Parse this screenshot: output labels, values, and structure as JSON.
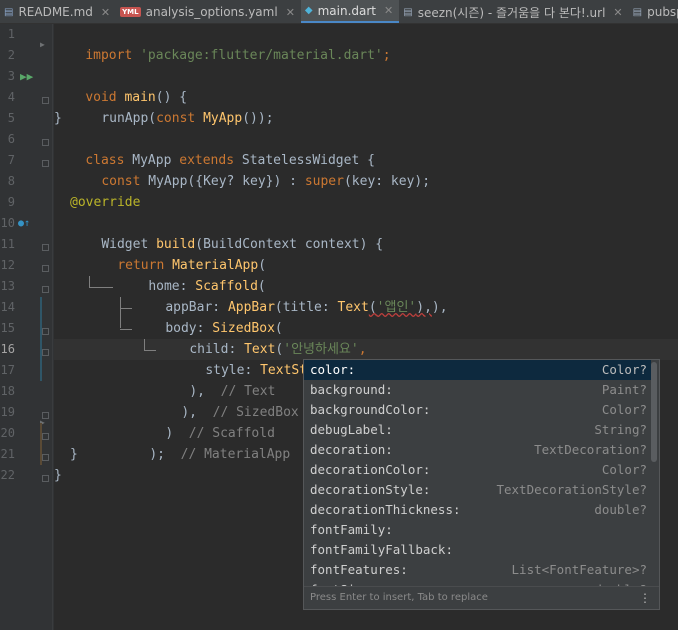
{
  "tabs": [
    {
      "label": "README.md",
      "icon": "markdown-file-icon",
      "active": false
    },
    {
      "label": "analysis_options.yaml",
      "icon": "yaml-file-icon",
      "active": false
    },
    {
      "label": "main.dart",
      "icon": "dart-file-icon",
      "active": true
    },
    {
      "label": "seezn(시즌) - 즐거움을 다 본다!.url",
      "icon": "url-file-icon",
      "active": false
    },
    {
      "label": "pubspe",
      "icon": "pubspec-file-icon",
      "active": false
    }
  ],
  "editor": {
    "line_numbers": [
      "1",
      "2",
      "3",
      "4",
      "5",
      "6",
      "7",
      "8",
      "9",
      "10",
      "11",
      "12",
      "13",
      "14",
      "15",
      "16",
      "17",
      "18",
      "19",
      "20",
      "21",
      "22"
    ],
    "current_line": "16",
    "code": {
      "l1_import": "import",
      "l1_str": "'package:flutter/material.dart'",
      "l1_semi": ";",
      "l3_void": "void",
      "l3_main": "main",
      "l3_rest": "() {",
      "l4_runapp": "runApp(",
      "l4_const": "const",
      "l4_myapp": "MyApp",
      "l4_end": "());",
      "l5": "}",
      "l6_class": "class",
      "l6_name": "MyApp",
      "l6_extends": "extends",
      "l6_base": "StatelessWidget {",
      "l7_const": "const",
      "l7_sig": "MyApp({Key? key}) : ",
      "l7_super": "super",
      "l7_end": "(key: key);",
      "l9_ann": "@override",
      "l10_type": "Widget",
      "l10_build": "build",
      "l10_params": "(BuildContext context) {",
      "l11_return": "return",
      "l11_widget": "MaterialApp",
      "l11_paren": "(",
      "l12_home": "home: ",
      "l12_widget": "Scaffold",
      "l12_paren": "(",
      "l13_appbar": "appBar: ",
      "l13_widget": "AppBar",
      "l13_title": "(title: ",
      "l13_text": "Text",
      "l13_open": "(",
      "l13_str": "'앱인'",
      "l13_close": "),",
      "l13_end": "),",
      "l14_body": "body: ",
      "l14_widget": "SizedBox",
      "l14_paren": "(",
      "l15_child": "child: ",
      "l15_widget": "Text",
      "l15_open": "(",
      "l15_str": "'안녕하세요'",
      "l15_comma": ",",
      "l16_style": "style: ",
      "l16_widget": "TextStyle",
      "l16_open": "(",
      "l16_close": ")",
      "l16_comma": ",",
      "l17_code": "),",
      "l17_cmt": "// Text",
      "l18_code": "),",
      "l18_cmt": "// SizedBox",
      "l19_code": ")",
      "l19_cmt": "// Scaffold",
      "l20_code": ");",
      "l20_cmt": "// MaterialApp",
      "l21": "}",
      "l22": "}"
    }
  },
  "autocomplete": {
    "items": [
      {
        "name": "color:",
        "type": "Color?"
      },
      {
        "name": "background:",
        "type": "Paint?"
      },
      {
        "name": "backgroundColor:",
        "type": "Color?"
      },
      {
        "name": "debugLabel:",
        "type": "String?"
      },
      {
        "name": "decoration:",
        "type": "TextDecoration?"
      },
      {
        "name": "decorationColor:",
        "type": "Color?"
      },
      {
        "name": "decorationStyle:",
        "type": "TextDecorationStyle?"
      },
      {
        "name": "decorationThickness:",
        "type": "double?"
      },
      {
        "name": "fontFamily:",
        "type": ""
      },
      {
        "name": "fontFamilyFallback:",
        "type": ""
      },
      {
        "name": "fontFeatures:",
        "type": "List<FontFeature>?"
      },
      {
        "name": "fontSize:",
        "type": "double?"
      }
    ],
    "footer_hint": "Press Enter to insert, Tab to replace",
    "more_icon": "more-vertical-icon"
  }
}
